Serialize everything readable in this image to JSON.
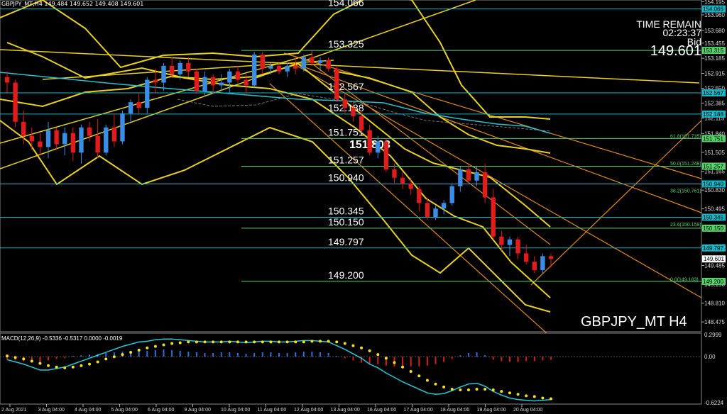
{
  "header": "GBPJPY_MT,H4  149.484 149.652 149.408 149.601",
  "info": {
    "time_remain_label": "TIME REMAIN",
    "time_remain": "02:23:37",
    "bid_label": "Bid",
    "bid": "149.601"
  },
  "symbol_label": "GBPJPY_MT H4",
  "center_label": "151.803",
  "macd_label": "MACD(12,26,9) -0.5336 -0.5317 0.0000 -0.0019",
  "colors": {
    "bull": "#3a8ee6",
    "bear": "#e11c1c",
    "level": "#55d36a",
    "cyan_level": "#16b6c4",
    "gold": "#e9d11f",
    "orange": "#e08a18",
    "macd_pos": "#2d6fe0",
    "macd_neg": "#d52020"
  },
  "chart_data": {
    "type": "candlestick",
    "ylim": [
      148.3,
      154.2
    ],
    "price_ticks": [
      "154.195",
      "153.960",
      "153.680",
      "153.455",
      "153.185",
      "152.915",
      "152.650",
      "152.385",
      "152.115",
      "151.840",
      "151.505",
      "151.165",
      "150.830",
      "150.495",
      "150.160",
      "149.825",
      "149.485",
      "149.150",
      "148.810",
      "148.475"
    ],
    "time_ticks": [
      "2 Aug 2021",
      "3 Aug 04:00",
      "4 Aug 04:00",
      "5 Aug 04:00",
      "6 Aug 04:00",
      "9 Aug 04:00",
      "10 Aug 04:00",
      "11 Aug 04:00",
      "12 Aug 04:00",
      "13 Aug 04:00",
      "16 Aug 04:00",
      "17 Aug 04:00",
      "18 Aug 04:00",
      "19 Aug 04:00",
      "20 Aug 04:00"
    ],
    "levels": [
      {
        "price": 154.066,
        "label": "154.066",
        "tag": "154.066",
        "kind": "cyan"
      },
      {
        "price": 153.325,
        "label": "153.325",
        "tag": "153.315",
        "kind": "green"
      },
      {
        "price": 152.567,
        "label": "152.567",
        "tag": "152.567",
        "kind": "cyan"
      },
      {
        "price": 152.188,
        "label": "152.188",
        "tag": "152.188",
        "kind": "cyan"
      },
      {
        "price": 151.751,
        "label": "151.751",
        "tag": "151.751",
        "kind": "green"
      },
      {
        "price": 151.257,
        "label": "151.257",
        "tag": "151.257",
        "kind": "green"
      },
      {
        "price": 150.94,
        "label": "150.940",
        "tag": "150.940",
        "kind": "cyan"
      },
      {
        "price": 150.345,
        "label": "150.345",
        "tag": "150.345",
        "kind": "cyan"
      },
      {
        "price": 150.15,
        "label": "150.150",
        "tag": "150.150",
        "kind": "green"
      },
      {
        "price": 149.797,
        "label": "149.797",
        "tag": "149.797",
        "kind": "cyan"
      },
      {
        "price": 149.2,
        "label": "149.200",
        "tag": "149.200",
        "kind": "green"
      }
    ],
    "fib_labels": [
      {
        "price": 151.735,
        "text": "61.8(151.735)"
      },
      {
        "price": 151.248,
        "text": "50.0(151.248)"
      },
      {
        "price": 150.761,
        "text": "38.2(150.761)"
      },
      {
        "price": 150.158,
        "text": "23.6(150.158)"
      },
      {
        "price": 149.183,
        "text": "0.0(149.183)"
      }
    ],
    "last_price": 149.601,
    "candles": [
      [
        152.85,
        152.95,
        152.55,
        152.75
      ],
      [
        152.75,
        152.8,
        151.95,
        152.05
      ],
      [
        152.05,
        152.25,
        151.65,
        151.8
      ],
      [
        151.8,
        151.95,
        151.55,
        151.7
      ],
      [
        151.7,
        151.85,
        151.45,
        151.6
      ],
      [
        151.6,
        152.05,
        151.4,
        151.9
      ],
      [
        151.9,
        151.95,
        151.55,
        151.65
      ],
      [
        151.65,
        151.95,
        151.45,
        151.85
      ],
      [
        151.85,
        151.95,
        151.35,
        151.5
      ],
      [
        151.5,
        152.0,
        151.3,
        151.95
      ],
      [
        151.95,
        152.05,
        151.7,
        151.8
      ],
      [
        151.8,
        152.1,
        151.4,
        151.5
      ],
      [
        151.5,
        152.0,
        151.45,
        151.95
      ],
      [
        151.95,
        152.2,
        151.6,
        151.7
      ],
      [
        151.7,
        152.25,
        151.65,
        152.2
      ],
      [
        152.2,
        152.45,
        152.05,
        152.4
      ],
      [
        152.4,
        152.55,
        152.2,
        152.3
      ],
      [
        152.3,
        152.85,
        152.2,
        152.8
      ],
      [
        152.8,
        153.0,
        152.55,
        152.75
      ],
      [
        152.75,
        153.1,
        152.6,
        153.05
      ],
      [
        153.05,
        153.2,
        152.85,
        152.9
      ],
      [
        152.9,
        153.15,
        152.8,
        153.1
      ],
      [
        153.1,
        153.2,
        152.85,
        152.95
      ],
      [
        152.95,
        153.0,
        152.55,
        152.6
      ],
      [
        152.6,
        152.95,
        152.5,
        152.85
      ],
      [
        152.85,
        152.9,
        152.55,
        152.7
      ],
      [
        152.7,
        152.9,
        152.6,
        152.75
      ],
      [
        152.75,
        153.0,
        152.55,
        152.95
      ],
      [
        152.95,
        153.05,
        152.75,
        152.8
      ],
      [
        152.8,
        152.9,
        152.55,
        152.7
      ],
      [
        152.7,
        153.3,
        152.65,
        153.25
      ],
      [
        153.25,
        153.3,
        152.9,
        153.0
      ],
      [
        153.0,
        153.1,
        152.9,
        153.05
      ],
      [
        153.05,
        153.1,
        152.9,
        152.95
      ],
      [
        152.95,
        153.1,
        152.85,
        153.05
      ],
      [
        153.05,
        153.2,
        152.9,
        153.0
      ],
      [
        153.0,
        153.25,
        152.95,
        153.2
      ],
      [
        153.2,
        153.32,
        153.05,
        153.1
      ],
      [
        153.1,
        153.2,
        152.95,
        153.15
      ],
      [
        153.15,
        153.2,
        152.95,
        153.0
      ],
      [
        153.0,
        153.05,
        152.4,
        152.45
      ],
      [
        152.45,
        152.55,
        152.2,
        152.3
      ],
      [
        152.3,
        152.4,
        152.05,
        152.15
      ],
      [
        152.15,
        152.25,
        151.85,
        151.9
      ],
      [
        151.9,
        152.0,
        151.45,
        151.5
      ],
      [
        151.5,
        151.8,
        151.4,
        151.7
      ],
      [
        151.7,
        151.75,
        151.15,
        151.2
      ],
      [
        151.2,
        151.3,
        150.95,
        151.05
      ],
      [
        151.05,
        151.15,
        150.85,
        150.95
      ],
      [
        150.95,
        151.05,
        150.75,
        150.85
      ],
      [
        150.85,
        150.9,
        150.45,
        150.6
      ],
      [
        150.6,
        150.7,
        150.3,
        150.35
      ],
      [
        150.35,
        150.55,
        150.3,
        150.5
      ],
      [
        150.5,
        150.65,
        150.4,
        150.6
      ],
      [
        150.6,
        150.95,
        150.55,
        150.9
      ],
      [
        150.9,
        151.25,
        150.8,
        151.2
      ],
      [
        151.2,
        151.3,
        150.95,
        151.0
      ],
      [
        151.0,
        151.25,
        150.9,
        151.15
      ],
      [
        151.15,
        151.3,
        150.6,
        150.7
      ],
      [
        150.7,
        150.85,
        149.95,
        150.0
      ],
      [
        150.0,
        150.1,
        149.75,
        149.85
      ],
      [
        149.85,
        150.0,
        149.65,
        149.95
      ],
      [
        149.95,
        150.0,
        149.6,
        149.7
      ],
      [
        149.7,
        149.85,
        149.5,
        149.55
      ],
      [
        149.55,
        149.65,
        149.35,
        149.4
      ],
      [
        149.4,
        149.7,
        149.35,
        149.65
      ],
      [
        149.65,
        149.7,
        149.45,
        149.6
      ]
    ],
    "macd": {
      "ylim": [
        -0.6224,
        0.2999
      ],
      "ticks": [
        "0.2999",
        "0.00",
        "-0.6224"
      ],
      "hist": [
        -0.03,
        -0.05,
        -0.06,
        -0.07,
        -0.07,
        -0.05,
        -0.03,
        -0.02,
        0.01,
        0.02,
        0.03,
        0.04,
        0.05,
        0.06,
        0.07,
        0.08,
        0.09,
        0.08,
        0.09,
        0.1,
        0.09,
        0.08,
        0.07,
        0.06,
        0.05,
        0.05,
        0.06,
        0.06,
        0.05,
        0.04,
        0.05,
        0.06,
        0.06,
        0.05,
        0.05,
        0.06,
        0.07,
        0.07,
        0.06,
        0.05,
        0.01,
        -0.02,
        -0.05,
        -0.08,
        -0.1,
        -0.1,
        -0.12,
        -0.13,
        -0.13,
        -0.13,
        -0.13,
        -0.12,
        -0.1,
        -0.07,
        -0.03,
        0.02,
        0.05,
        0.06,
        0.02,
        -0.04,
        -0.06,
        -0.07,
        -0.07,
        -0.06,
        -0.06,
        -0.05,
        -0.04
      ],
      "macd_line": [
        -0.04,
        -0.07,
        -0.1,
        -0.14,
        -0.18,
        -0.18,
        -0.16,
        -0.14,
        -0.1,
        -0.06,
        -0.02,
        0.02,
        0.06,
        0.1,
        0.14,
        0.17,
        0.2,
        0.21,
        0.23,
        0.24,
        0.24,
        0.23,
        0.22,
        0.21,
        0.2,
        0.2,
        0.2,
        0.21,
        0.2,
        0.19,
        0.2,
        0.21,
        0.21,
        0.2,
        0.2,
        0.21,
        0.22,
        0.22,
        0.21,
        0.2,
        0.15,
        0.1,
        0.04,
        -0.02,
        -0.1,
        -0.15,
        -0.22,
        -0.28,
        -0.34,
        -0.39,
        -0.44,
        -0.49,
        -0.51,
        -0.5,
        -0.46,
        -0.41,
        -0.37,
        -0.36,
        -0.4,
        -0.47,
        -0.52,
        -0.56,
        -0.58,
        -0.59,
        -0.6,
        -0.59,
        -0.58
      ],
      "signal_line": [
        0.01,
        -0.01,
        -0.03,
        -0.06,
        -0.09,
        -0.12,
        -0.14,
        -0.15,
        -0.14,
        -0.12,
        -0.1,
        -0.07,
        -0.03,
        0.0,
        0.03,
        0.06,
        0.09,
        0.12,
        0.14,
        0.16,
        0.18,
        0.19,
        0.2,
        0.2,
        0.2,
        0.2,
        0.2,
        0.2,
        0.2,
        0.2,
        0.2,
        0.2,
        0.2,
        0.2,
        0.2,
        0.2,
        0.2,
        0.21,
        0.21,
        0.21,
        0.2,
        0.18,
        0.15,
        0.12,
        0.08,
        0.03,
        -0.02,
        -0.08,
        -0.14,
        -0.2,
        -0.26,
        -0.32,
        -0.37,
        -0.41,
        -0.44,
        -0.45,
        -0.45,
        -0.44,
        -0.44,
        -0.45,
        -0.47,
        -0.49,
        -0.51,
        -0.53,
        -0.54,
        -0.56,
        -0.57
      ]
    }
  }
}
